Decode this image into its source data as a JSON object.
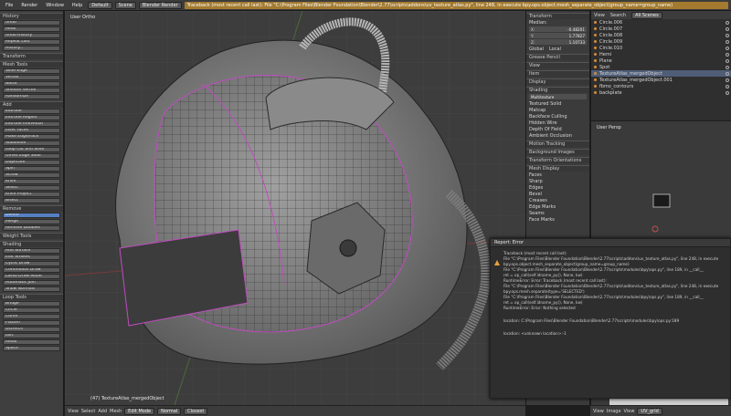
{
  "topbar": {
    "menu": [
      "File",
      "Render",
      "Window",
      "Help"
    ],
    "layout_selector": "Default",
    "scene_selector": "Scene",
    "engine_selector": "Blender Render",
    "report_strip": "Traceback (most recent call last): File \"C:\\Program Files\\Blender Foundation\\Blender\\2.77\\scripts\\addons\\uv_texture_atlas.py\", line 248, in execute bpy.ops.object.mesh_separate_object(group_name=group_name)"
  },
  "toolshelf": {
    "sections": [
      {
        "title": "History",
        "items": [
          "Undo",
          "Redo",
          "Undo History",
          "Repeat Last",
          "History..."
        ]
      },
      {
        "title": "Transform",
        "items": []
      },
      {
        "title": "Mesh Tools",
        "items": [
          "Slide Edge",
          "Vertex",
          "Noise",
          "Smooth Vertex",
          "Randomize"
        ]
      },
      {
        "title": "Add",
        "items": [
          "Extrude",
          "Extrude Region",
          "Extrude Individual",
          "Inset Faces",
          "Make Edge/Face",
          "Subdivide",
          "Loop Cut and Slide",
          "Offset Edge Slide",
          "Duplicate",
          "Spin",
          "Screw",
          "Knife",
          "Select",
          "Knife Project",
          "Bisect"
        ]
      },
      {
        "title": "Remove",
        "items": [
          "Delete",
          "Merge",
          "Remove Doubles"
        ]
      },
      {
        "title": "Weight Tools",
        "items": []
      },
      {
        "title": "Shading",
        "items": [
          "Add Surface",
          "Edit Strokes",
          "Cyclic Draw",
          "Continuous Draw",
          "Lasso Draw Mode",
          "Automatic Join",
          "Show Normals"
        ]
      },
      {
        "title": "Loop Tools",
        "items": [
          "Bridge",
          "Circle",
          "Curve",
          "Flatten",
          "Gstretch",
          "Loft",
          "Relax",
          "Space"
        ]
      }
    ]
  },
  "viewport": {
    "label": "User Ortho",
    "object_label": "(47) TextureAtlas_mergedObject",
    "grid_color": "#585858",
    "model_color": "#8d8d8d",
    "seam_color": "#c04cc0"
  },
  "nprops": {
    "transform_header": "Transform",
    "median_label": "Median:",
    "median": {
      "x_label": "X:",
      "x": "-0.48201",
      "y_label": "Y:",
      "y": "1.77827",
      "z_label": "Z:",
      "z": "1.10733"
    },
    "global_label": "Global",
    "local_label": "Local",
    "grease_pencil": "Grease Pencil",
    "view": "View",
    "item": "Item",
    "display": "Display",
    "shading": "Shading",
    "multitexture": "Multitexture",
    "options": [
      "Textured Solid",
      "Matcap",
      "Backface Culling",
      "Hidden Wire",
      "Depth Of Field",
      "Ambient Occlusion"
    ],
    "motion_tracking": "Motion Tracking",
    "background_images": "Background Images",
    "transform_orientations": "Transform Orientations",
    "mesh_display": "Mesh Display",
    "overlays": [
      "Faces",
      "Sharp",
      "Edges",
      "Bevel",
      "Creases",
      "Edge Marks",
      "Seams",
      "Face Marks"
    ]
  },
  "outliner": {
    "buttons": [
      "View",
      "Search"
    ],
    "scene_filter": "All Scenes",
    "items": [
      {
        "label": "Circle.006"
      },
      {
        "label": "Circle.007"
      },
      {
        "label": "Circle.008"
      },
      {
        "label": "Circle.009"
      },
      {
        "label": "Circle.010"
      },
      {
        "label": "Hemi"
      },
      {
        "label": "Plane"
      },
      {
        "label": "Spot"
      },
      {
        "label": "TextureAtlas_mergedObject"
      },
      {
        "label": "TextureAtlas_mergedObject.001"
      },
      {
        "label": "fbmo_contours"
      },
      {
        "label": "backplate"
      }
    ]
  },
  "userpersp": {
    "label": "User Persp"
  },
  "bottombar": {
    "menu": [
      "View",
      "Select",
      "Add",
      "Mesh"
    ],
    "mode": "Edit Mode",
    "pivot": "Normal",
    "closest": "Closest"
  },
  "rbottom": {
    "menu": [
      "View",
      "Image",
      "View"
    ],
    "uv": "UV_grid"
  },
  "report_error": {
    "title": "Report: Error",
    "lines": [
      "Traceback (most recent call last):",
      "File \"C:\\Program Files\\Blender Foundation\\Blender\\2.77\\scripts\\addons\\uv_texture_atlas.py\", line 248, in execute",
      "bpy.ops.object.mesh_separate_object(group_name=group_name)",
      "File \"C:\\Program Files\\Blender Foundation\\Blender\\2.77\\scripts\\modules\\bpy\\ops.py\", line 189, in __call__",
      "ret = op_call(self.idname_py(), None, kw)",
      "RuntimeError: Error: Traceback (most recent call last):",
      "File \"C:\\Program Files\\Blender Foundation\\Blender\\2.77\\scripts\\addons\\uv_texture_atlas.py\", line 248, in execute",
      "bpy.ops.mesh.separate(type='SELECTED')",
      "File \"C:\\Program Files\\Blender Foundation\\Blender\\2.77\\scripts\\modules\\bpy\\ops.py\", line 189, in __call__",
      "ret = op_call(self.idname_py(), None, kw)",
      "RuntimeError: Error: Nothing selected",
      "location: C:\\Program Files\\Blender Foundation\\Blender\\2.77\\scripts\\modules\\bpy\\ops.py:189",
      "location: <unknown location>:-1"
    ]
  }
}
